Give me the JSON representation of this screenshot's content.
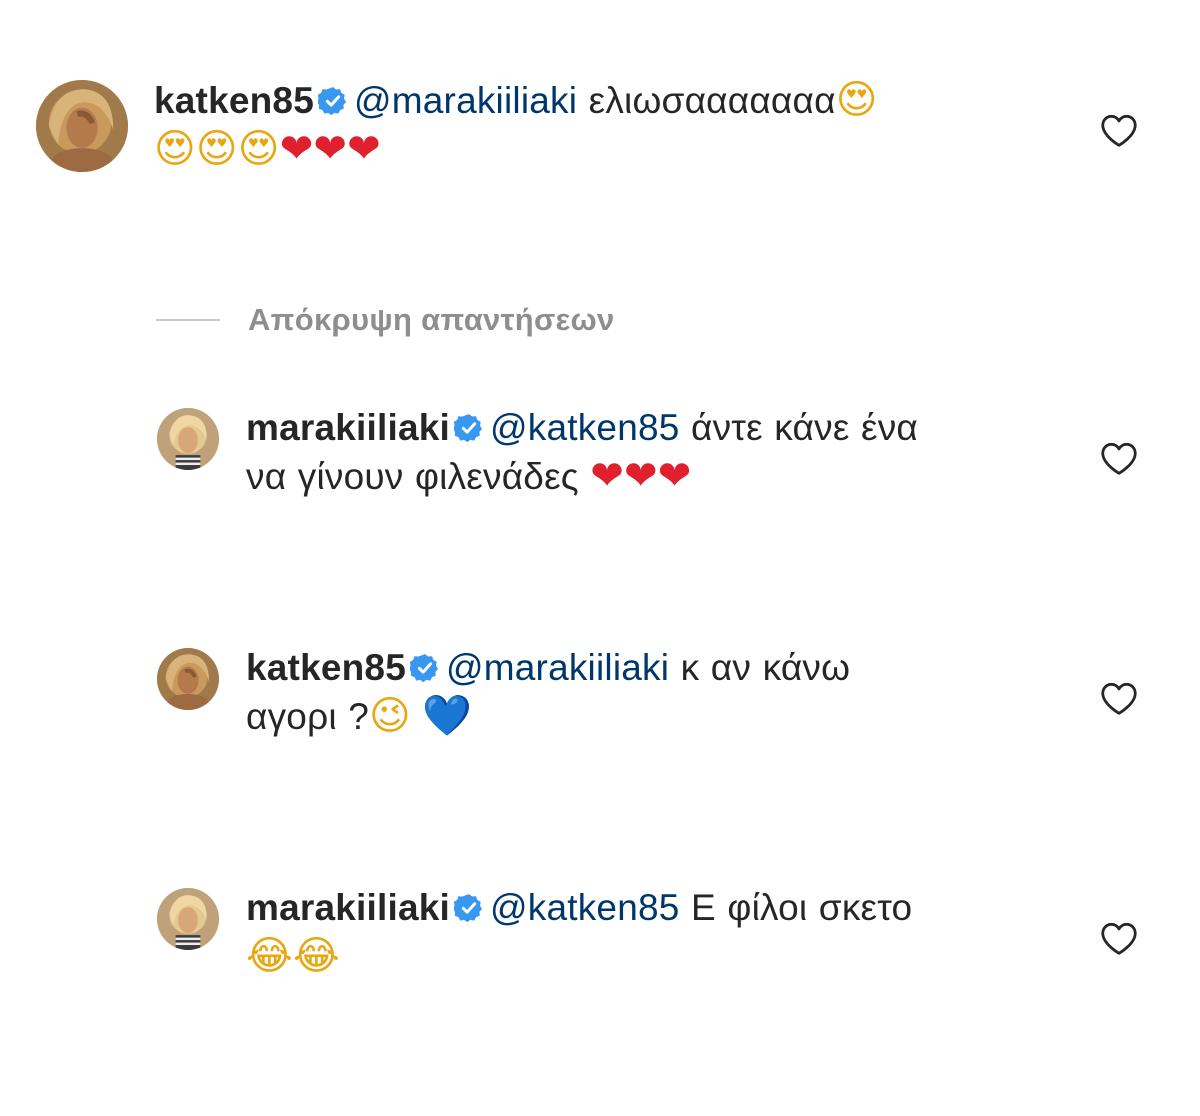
{
  "comments": [
    {
      "username": "katken85",
      "mention": "@marakiiliaki",
      "line1": "ελιωσααααααα",
      "line1_emoji": "😍",
      "line2_emoji": "😍😍😍",
      "line2_hearts": "❤❤❤",
      "avatar_icon": "avatar-katken85"
    },
    {
      "username": "marakiiliaki",
      "mention": "@katken85",
      "line1": "άντε κάνε ένα",
      "line2": "να γίνουν φιλενάδες",
      "line2_hearts": "❤❤❤",
      "avatar_icon": "avatar-marakiiliaki"
    },
    {
      "username": "katken85",
      "mention": "@marakiiliaki",
      "line1": "κ αν κάνω",
      "line2": "αγορι ?",
      "line2_emoji": "😉",
      "line2_heart": "💙",
      "avatar_icon": "avatar-katken85"
    },
    {
      "username": "marakiiliaki",
      "mention": "@katken85",
      "line1": "Ε φίλοι σκετο",
      "line2_emoji": "😂😂",
      "avatar_icon": "avatar-marakiiliaki"
    }
  ],
  "hide_replies_label": "Απόκρυψη απαντήσεων",
  "colors": {
    "text": "#262626",
    "mention": "#00376b",
    "muted": "#8e8e8e",
    "verified": "#3897f0",
    "heart_outline": "#262626"
  },
  "icons": {
    "verified": "verified-badge-icon",
    "like": "heart-outline-icon"
  }
}
